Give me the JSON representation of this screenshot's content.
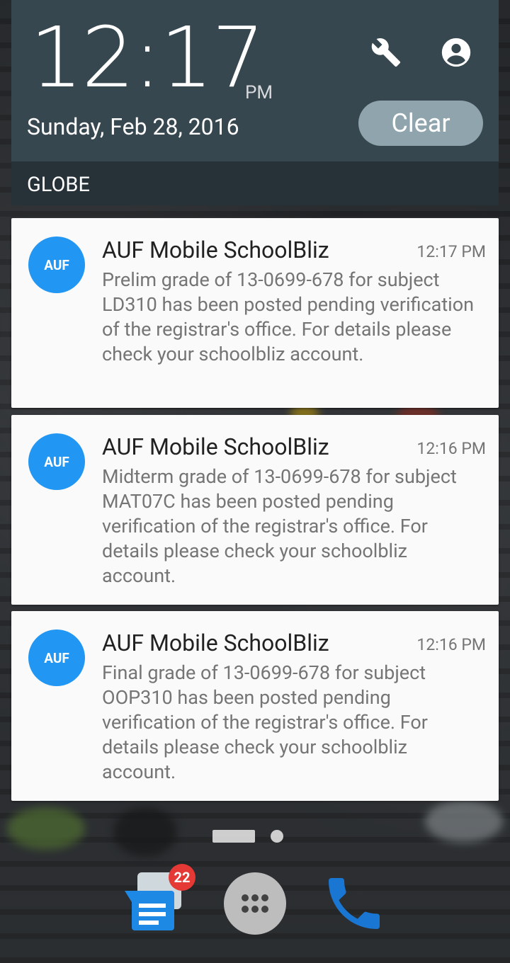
{
  "status": {
    "time": "12:17",
    "ampm": "PM",
    "date": "Sunday, Feb 28, 2016",
    "carrier": "GLOBE",
    "clear_label": "Clear",
    "settings_icon": "wrench-icon",
    "user_icon": "account-icon"
  },
  "notifications": [
    {
      "avatar": "AUF",
      "app": "AUF Mobile SchoolBliz",
      "time": "12:17 PM",
      "message": "Prelim grade of 13-0699-678 for subject LD310 has been posted pending verification of the registrar's office. For details please check your schoolbliz account."
    },
    {
      "avatar": "AUF",
      "app": "AUF Mobile SchoolBliz",
      "time": "12:16 PM",
      "message": "Midterm grade of 13-0699-678 for subject MAT07C has been posted pending verification of the registrar's office. For details please check your schoolbliz account."
    },
    {
      "avatar": "AUF",
      "app": "AUF Mobile SchoolBliz",
      "time": "12:16 PM",
      "message": "Final grade of 13-0699-678 for subject OOP310 has been posted pending verification of the registrar's office. For details please check your schoolbliz account."
    }
  ],
  "dock": {
    "messages_badge": "22",
    "colors": {
      "avatar": "#2196f3",
      "badge": "#e53935",
      "phone": "#1976d2",
      "messages": "#1e88e5"
    }
  }
}
